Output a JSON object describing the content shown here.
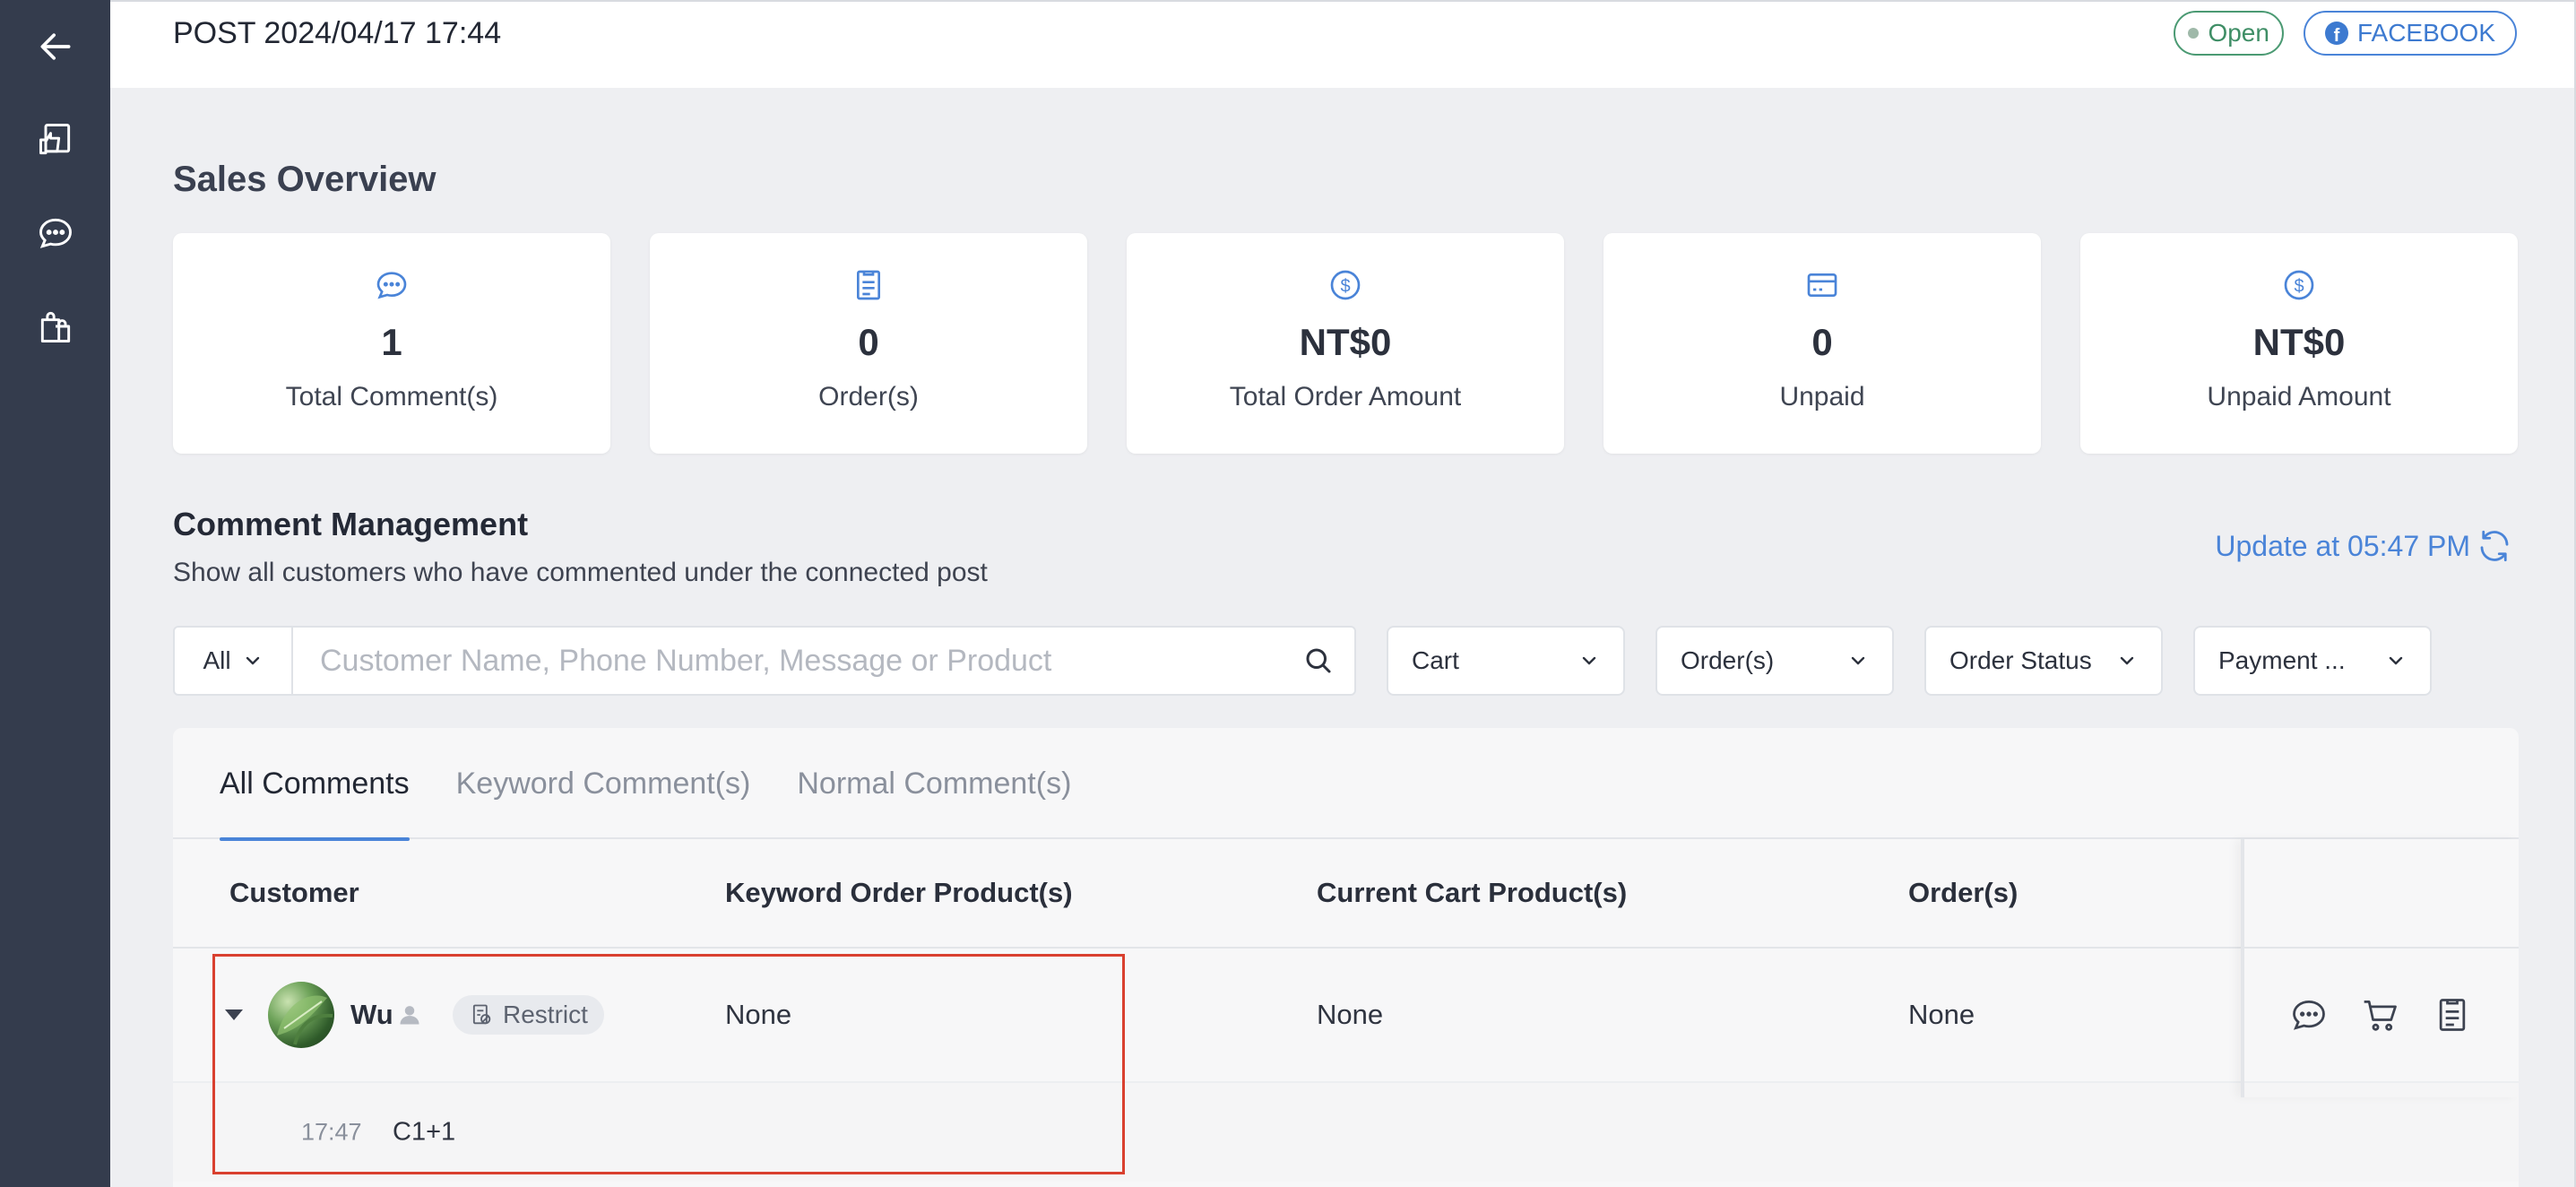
{
  "sidebar": {
    "items": [
      {
        "icon": "arrow-left-icon"
      },
      {
        "icon": "post-like-icon"
      },
      {
        "icon": "chat-bubble-icon"
      },
      {
        "icon": "shopping-bags-icon"
      }
    ]
  },
  "header": {
    "post_title": "POST 2024/04/17 17:44",
    "status_label": "Open",
    "platform_label": "FACEBOOK"
  },
  "sales_overview": {
    "title": "Sales Overview",
    "cards": [
      {
        "icon": "comment-icon",
        "value": "1",
        "label": "Total Comment(s)"
      },
      {
        "icon": "order-clipboard-icon",
        "value": "0",
        "label": "Order(s)"
      },
      {
        "icon": "dollar-coin-icon",
        "value": "NT$0",
        "label": "Total Order Amount"
      },
      {
        "icon": "credit-card-icon",
        "value": "0",
        "label": "Unpaid"
      },
      {
        "icon": "dollar-coin-icon",
        "value": "NT$0",
        "label": "Unpaid Amount"
      }
    ]
  },
  "comment_management": {
    "title": "Comment Management",
    "subtitle": "Show all customers who have commented under the connected post",
    "update_label": "Update at 05:47 PM"
  },
  "filters": {
    "scope_value": "All",
    "search_placeholder": "Customer Name, Phone Number, Message or Product",
    "search_value": "",
    "dropdowns": [
      "Cart",
      "Order(s)",
      "Order Status",
      "Payment ..."
    ]
  },
  "tabs": [
    {
      "label": "All Comments",
      "active": true
    },
    {
      "label": "Keyword Comment(s)",
      "active": false
    },
    {
      "label": "Normal Comment(s)",
      "active": false
    }
  ],
  "table": {
    "columns": [
      "Customer",
      "Keyword Order Product(s)",
      "Current Cart Product(s)",
      "Order(s)"
    ],
    "rows": [
      {
        "customer": "Wu",
        "restrict_label": "Restrict",
        "keyword_products": "None",
        "cart_products": "None",
        "orders": "None",
        "comments": [
          {
            "time": "17:47",
            "message": "C1+1"
          }
        ]
      }
    ]
  },
  "colors": {
    "sidebar_bg": "#343c4d",
    "accent": "#4a84d8",
    "status_open": "#3f8e66",
    "highlight": "#d9402f"
  }
}
